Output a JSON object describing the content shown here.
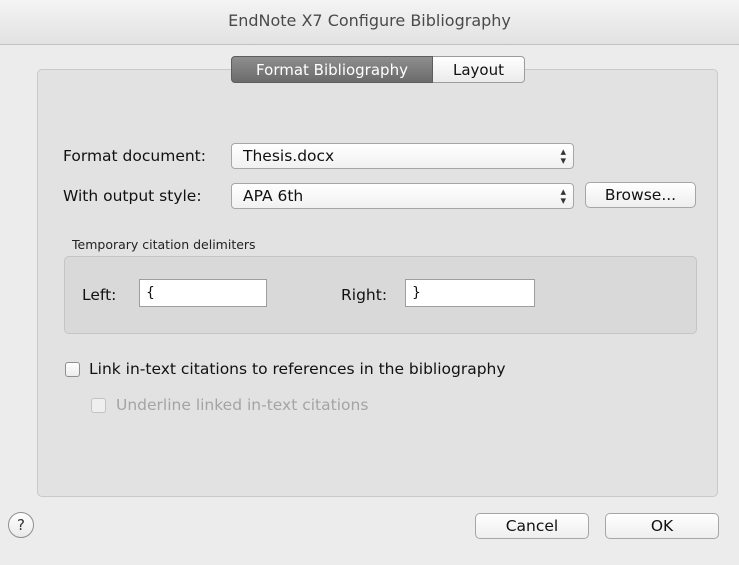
{
  "window": {
    "title": "EndNote X7 Configure Bibliography"
  },
  "tabs": [
    {
      "label": "Format Bibliography",
      "selected": true
    },
    {
      "label": "Layout",
      "selected": false
    }
  ],
  "format_document": {
    "label": "Format document:",
    "value": "Thesis.docx"
  },
  "output_style": {
    "label": "With output style:",
    "value": "APA 6th",
    "browse_label": "Browse..."
  },
  "delimiters": {
    "section_label": "Temporary citation delimiters",
    "left_label": "Left:",
    "left_value": "{",
    "right_label": "Right:",
    "right_value": "}"
  },
  "options": {
    "link_label": "Link in-text citations to references in the bibliography",
    "link_checked": false,
    "underline_label": "Underline linked in-text citations",
    "underline_checked": false,
    "underline_enabled": false
  },
  "footer": {
    "help_symbol": "?",
    "cancel_label": "Cancel",
    "ok_label": "OK"
  },
  "icons": {
    "help": "help-icon",
    "popup_arrows": "updown-arrows-icon"
  }
}
